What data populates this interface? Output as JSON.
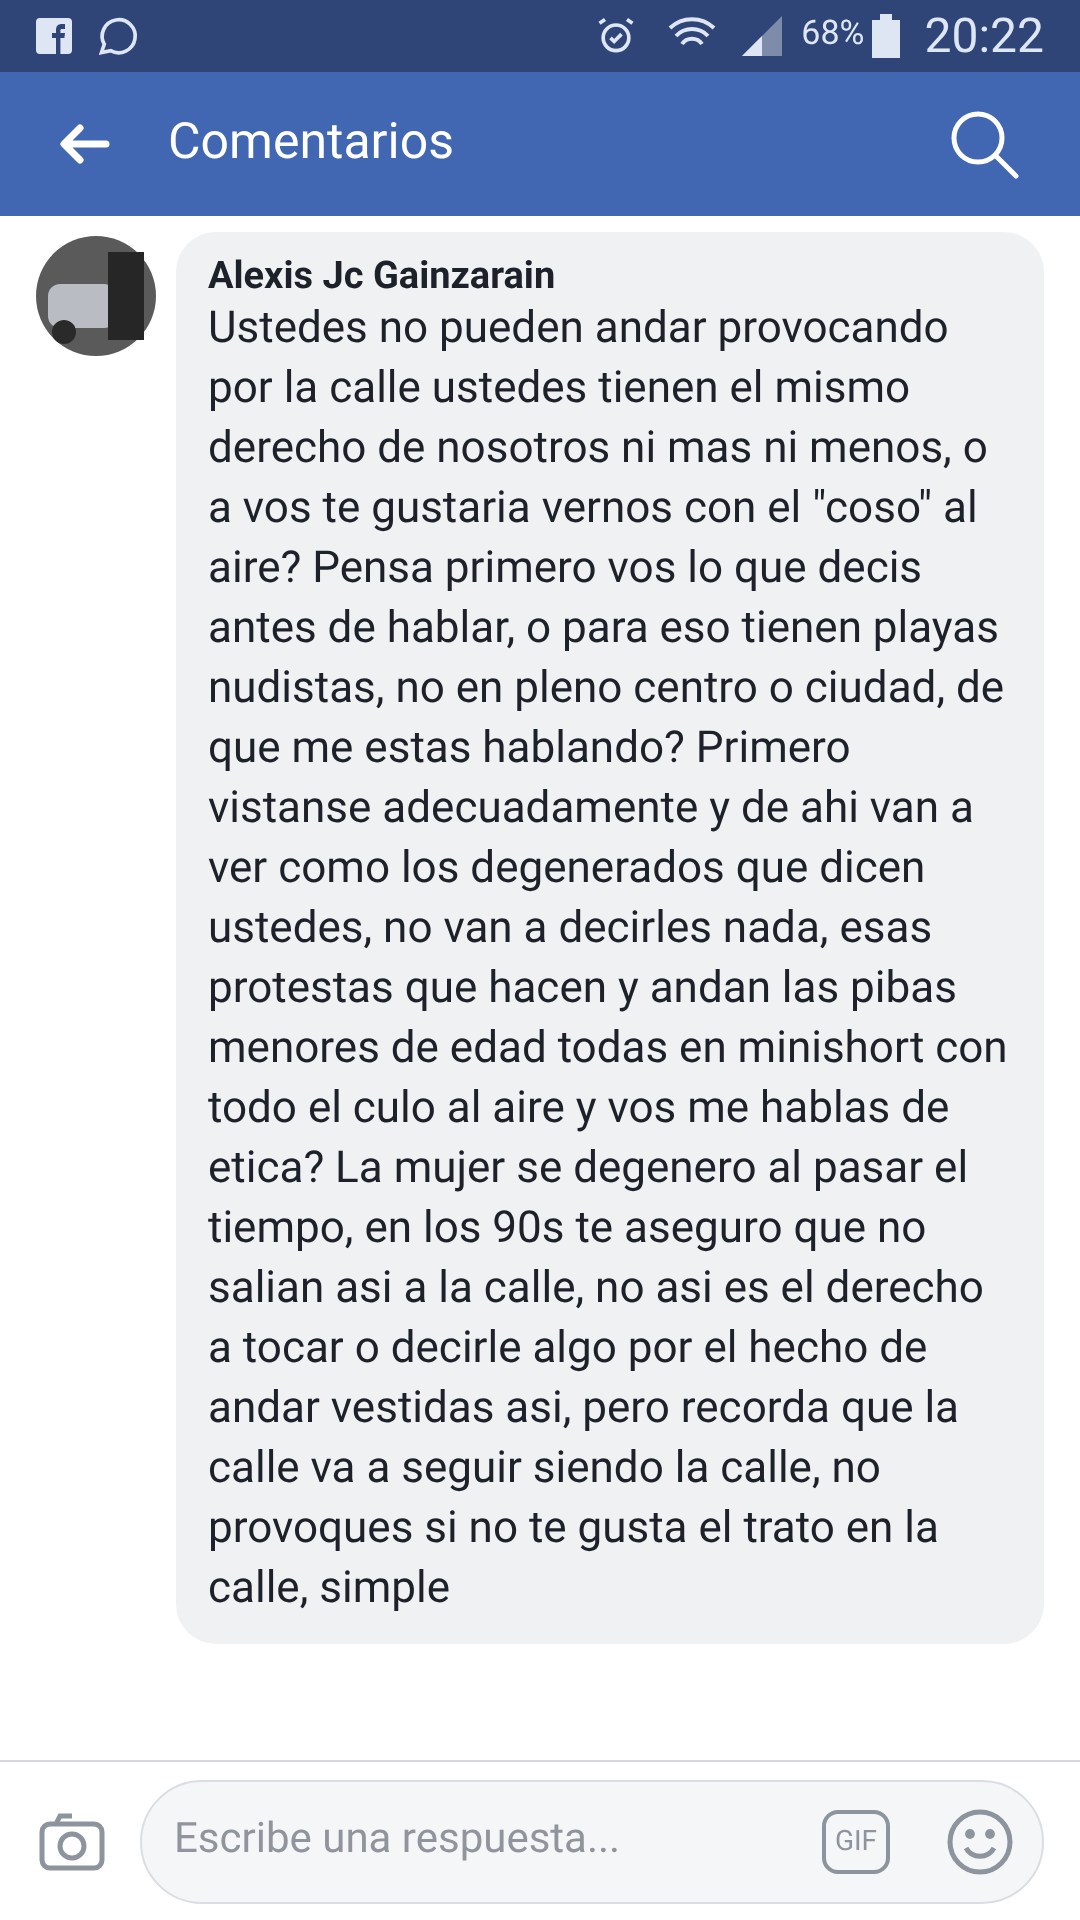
{
  "status_bar": {
    "battery": "68%",
    "time": "20:22"
  },
  "header": {
    "title": "Comentarios"
  },
  "comment": {
    "author": "Alexis Jc Gainzarain",
    "text": "Ustedes no pueden andar provocando por la calle ustedes tienen el mismo derecho de nosotros ni mas ni menos, o a vos te gustaria vernos con el \"coso\" al aire? Pensa primero vos lo que decis antes de hablar, o para eso tienen playas nudistas, no en pleno centro o ciudad, de que me estas hablando? Primero vistanse adecuadamente y de ahi van a ver como los degenerados que dicen ustedes, no van a decirles nada, esas protestas que hacen y andan las pibas menores de edad todas en minishort con todo el culo al aire y vos me hablas de etica? La mujer se degenero al pasar el tiempo, en los 90s te aseguro que no salian asi a la calle, no asi es el derecho a tocar o decirle algo por el hecho de andar vestidas asi, pero recorda que la calle va a seguir siendo la calle, no provoques si no te gusta el trato en la calle, simple"
  },
  "reply_bar": {
    "placeholder": "Escribe una respuesta...",
    "gif": "GIF"
  }
}
